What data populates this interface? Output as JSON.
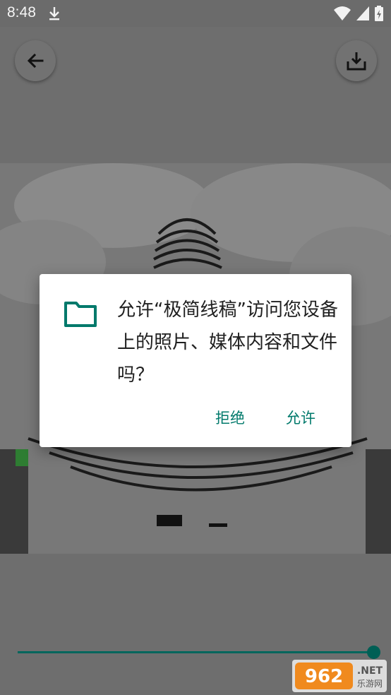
{
  "status_bar": {
    "time": "8:48",
    "icons": [
      "download-icon",
      "wifi-icon",
      "signal-icon",
      "battery-icon"
    ]
  },
  "toolbar": {
    "back_icon": "arrow-left-icon",
    "save_icon": "download-to-tray-icon"
  },
  "dialog": {
    "message": "允许“极简线稿”访问您设备上的照片、媒体内容和文件吗？",
    "deny_label": "拒绝",
    "allow_label": "允许",
    "icon": "folder-icon"
  },
  "slider": {
    "value_fraction": 1.0
  },
  "watermark": {
    "brand": "962.NET",
    "sub": "乐游网"
  },
  "colors": {
    "accent": "#00796b",
    "scrim_bg": "#6e6e6e",
    "dialog_bg": "#ffffff"
  }
}
